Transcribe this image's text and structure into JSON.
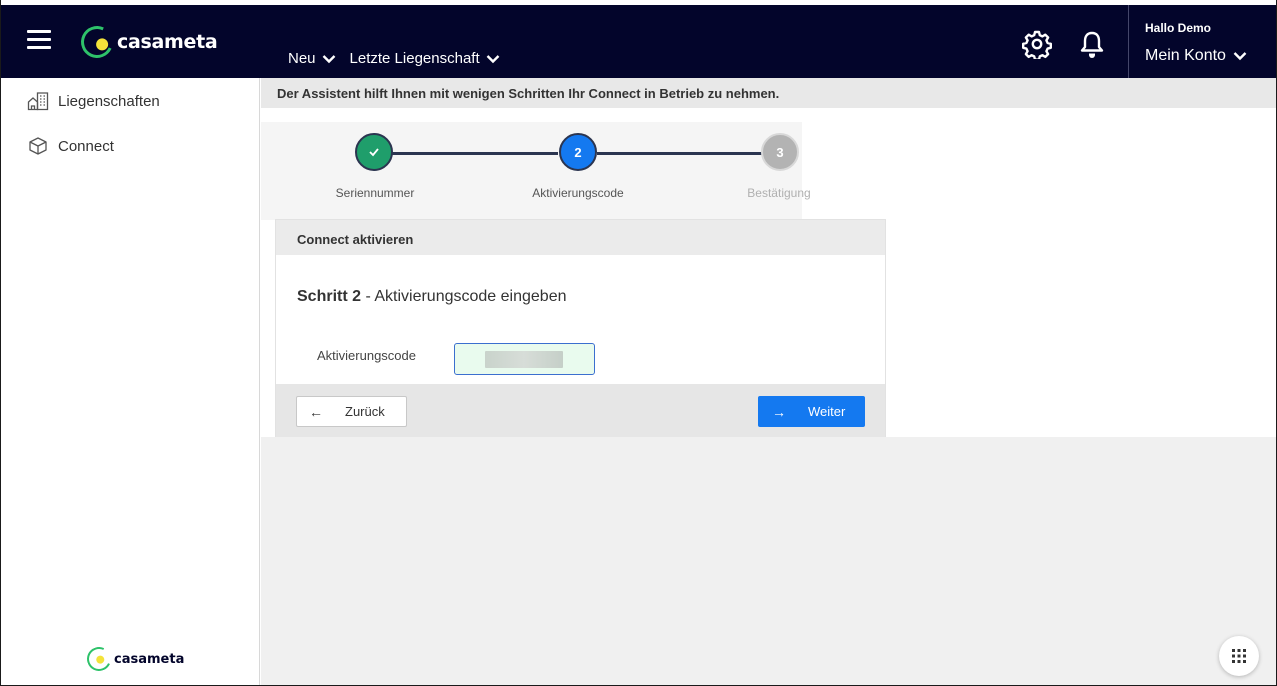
{
  "header": {
    "logo_text": "casameta",
    "nav": [
      {
        "label": "Neu"
      },
      {
        "label": "Letzte Liegenschaft"
      }
    ],
    "greeting": "Hallo Demo",
    "account_label": "Mein Konto",
    "icons": [
      "menu-icon",
      "settings-gear-icon",
      "bell-icon"
    ]
  },
  "sidebar": {
    "items": [
      {
        "label": "Liegenschaften",
        "icon": "buildings-icon"
      },
      {
        "label": "Connect",
        "icon": "cube-icon"
      }
    ],
    "footer_logo_text": "casameta"
  },
  "main": {
    "info_text": "Der Assistent hilft Ihnen mit wenigen Schritten Ihr Connect in Betrieb zu nehmen.",
    "stepper": {
      "steps": [
        {
          "number": "1",
          "label": "Seriennummer",
          "state": "done"
        },
        {
          "number": "2",
          "label": "Aktivierungscode",
          "state": "active"
        },
        {
          "number": "3",
          "label": "Bestätigung",
          "state": "pending"
        }
      ]
    },
    "card": {
      "title": "Connect aktivieren",
      "step_bold": "Schritt 2",
      "step_text": " - Aktivierungscode eingeben",
      "field_label": "Aktivierungscode",
      "field_value": "",
      "back_label": "Zurück",
      "next_label": "Weiter"
    }
  },
  "colors": {
    "header_bg": "#03052b",
    "brand_green": "#2ec26a",
    "brand_yellow": "#f4e33a",
    "step_done": "#1f9e6b",
    "step_active": "#1479f0",
    "step_pending": "#b3b3b3",
    "primary_button": "#1479f0"
  }
}
